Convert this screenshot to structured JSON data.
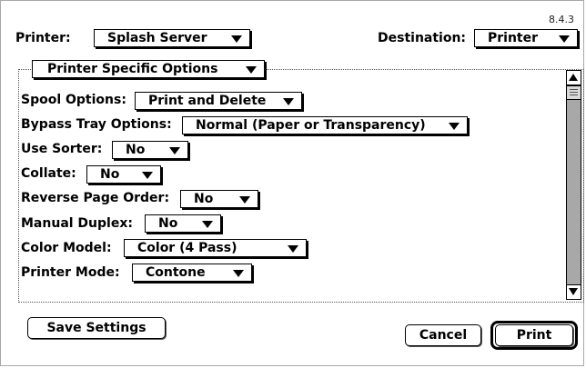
{
  "version": "8.4.3",
  "printer": {
    "label": "Printer:",
    "value": "Splash Server"
  },
  "destination": {
    "label": "Destination:",
    "value": "Printer"
  },
  "panel": {
    "value": "Printer Specific Options"
  },
  "options": [
    {
      "label": "Spool Options:",
      "value": "Print and Delete"
    },
    {
      "label": "Bypass Tray Options:",
      "value": "Normal (Paper or Transparency)"
    },
    {
      "label": "Use Sorter:",
      "value": "No"
    },
    {
      "label": "Collate:",
      "value": "No"
    },
    {
      "label": "Reverse Page Order:",
      "value": "No"
    },
    {
      "label": "Manual Duplex:",
      "value": "No"
    },
    {
      "label": "Color Model:",
      "value": "Color (4 Pass)"
    },
    {
      "label": "Printer Mode:",
      "value": "Contone"
    }
  ],
  "buttons": {
    "save_settings": "Save Settings",
    "cancel": "Cancel",
    "print": "Print"
  }
}
